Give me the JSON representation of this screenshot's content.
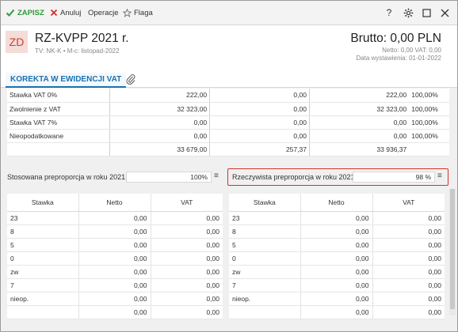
{
  "toolbar": {
    "save_label": "ZAPISZ",
    "cancel_label": "Anuluj",
    "operations_label": "Operacje",
    "flag_label": "Flaga",
    "help_label": "?"
  },
  "header": {
    "badge": "ZD",
    "title": "RZ-KVPP 2021 r.",
    "subtitle": "TV: NK-K  •  M-c: listopad-2022",
    "gross": "Brutto: 0,00 PLN",
    "net_vat": "Netto: 0,00 VAT: 0,00",
    "issue_date": "Data wystawienia: 01-01-2022"
  },
  "section": {
    "tab_label": "KOREKTA W EWIDENCJI VAT"
  },
  "rates": {
    "rows": [
      {
        "label": "Stawka VAT 0%",
        "a": "222,00",
        "b": "0,00",
        "c": "222,00",
        "pct": "100,00%"
      },
      {
        "label": "Zwolnienie z VAT",
        "a": "32 323,00",
        "b": "0,00",
        "c": "32 323,00",
        "pct": "100,00%"
      },
      {
        "label": "Stawka VAT 7%",
        "a": "0,00",
        "b": "0,00",
        "c": "0,00",
        "pct": "100,00%"
      },
      {
        "label": "Nieopodatkowane",
        "a": "0,00",
        "b": "0,00",
        "c": "0,00",
        "pct": "100,00%"
      }
    ],
    "totals": {
      "a": "33 679,00",
      "b": "257,37",
      "c": "33 936,37"
    }
  },
  "preproportion": {
    "applied_label": "Stosowana preproporcja w roku 2021:",
    "applied_value": "100%",
    "actual_label": "Rzeczywista preproporcja w roku 2021:",
    "actual_value": "98 %"
  },
  "vat_table": {
    "headers": [
      "Stawka",
      "Netto",
      "VAT"
    ],
    "rows": [
      {
        "rate": "23",
        "net": "0,00",
        "vat": "0,00"
      },
      {
        "rate": "8",
        "net": "0,00",
        "vat": "0,00"
      },
      {
        "rate": "5",
        "net": "0,00",
        "vat": "0,00"
      },
      {
        "rate": "0",
        "net": "0,00",
        "vat": "0,00"
      },
      {
        "rate": "zw",
        "net": "0,00",
        "vat": "0,00"
      },
      {
        "rate": "7",
        "net": "0,00",
        "vat": "0,00"
      },
      {
        "rate": "nieop.",
        "net": "0,00",
        "vat": "0,00"
      }
    ],
    "totals": {
      "net": "0,00",
      "vat": "0,00"
    }
  },
  "colors": {
    "accent": "#1a72b3",
    "save": "#2e9a3a",
    "cancel": "#d32f2f",
    "badge_bg": "#f4dcd8",
    "badge_fg": "#c64232",
    "highlight_border": "#d32f2f"
  },
  "icons": {
    "save": "check-icon",
    "cancel": "x-icon",
    "flag": "star-icon",
    "help": "help-icon",
    "settings": "gear-icon",
    "maximize": "square-icon",
    "close": "close-icon",
    "attachment": "paperclip-icon",
    "menu": "hamburger-icon"
  }
}
